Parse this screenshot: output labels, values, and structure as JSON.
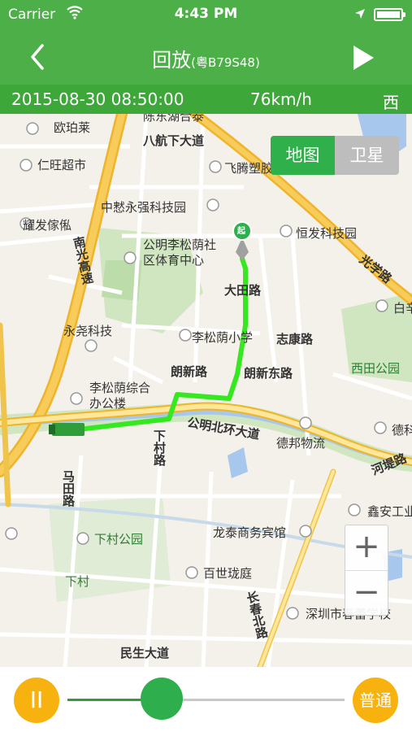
{
  "status_bar": {
    "carrier": "Carrier",
    "time": "4:43 PM"
  },
  "nav": {
    "title": "回放",
    "plate": "(粤B79S48)"
  },
  "info": {
    "datetime": "2015-08-30 08:50:00",
    "speed": "76km/h",
    "direction": "西"
  },
  "map_toggle": {
    "map": "地图",
    "satellite": "卫星"
  },
  "map_labels": {
    "oupaolai": "欧珀莱",
    "renwang": "仁旺超市",
    "yaofa": "耀发傢俬",
    "nanguang": "南光高速",
    "yongyao": "永尧科技",
    "licai_top": "陈东湖合泰",
    "bahang": "八航下大道",
    "feiteng": "飞腾塑胶",
    "zhongkai": "中慭永强科技园",
    "hengfa": "恒发科技园",
    "guangxue": "光学路",
    "gongming_sports": "公明李松荫社区体育中心",
    "datian": "大田路",
    "lisongyin_school": "李松荫小学",
    "zhikang": "志康路",
    "baiyan": "白辛",
    "xitian_park": "西田公园",
    "langxin": "朗新路",
    "langxindong": "朗新东路",
    "lisongyin_office": "李松荫综合办公楼",
    "huanda": "公明北环大道",
    "debang": "德邦物流",
    "hedi": "河堤路",
    "deke": "德科",
    "xiacun_road": "下村路",
    "matian": "马田路",
    "xinan": "鑫安工业",
    "xiacun_park": "下村公园",
    "longtai": "龙泰商务宾馆",
    "xiacun": "下村",
    "baishi": "百世珑庭",
    "changchun": "长春北路",
    "shenzhen_school": "深圳市春蕾学校",
    "minsheng": "民生大道",
    "start_marker": "起"
  },
  "zoom": {
    "in": "+",
    "out": "−"
  },
  "controls": {
    "pause": "II",
    "speed_label": "普通",
    "progress": 0.34
  },
  "colors": {
    "primary_green": "#4caf47",
    "route_green": "#36e81f",
    "accent_orange": "#f7b20f"
  }
}
